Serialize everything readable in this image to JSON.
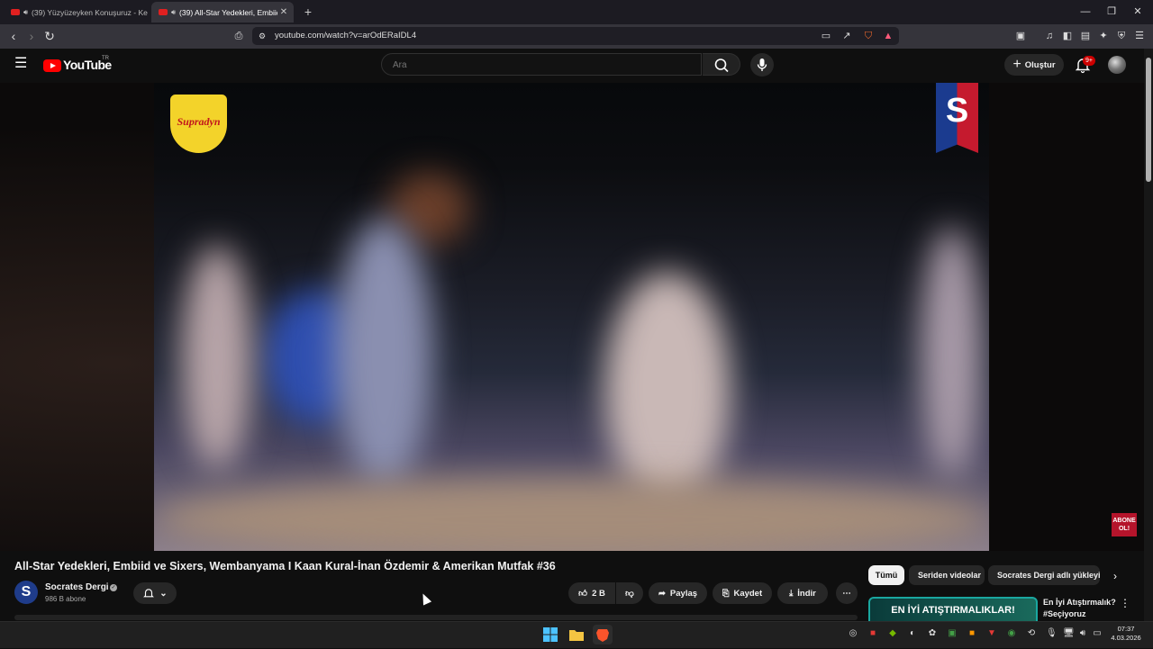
{
  "browser": {
    "tabs": [
      {
        "title": "(39) Yüzyüzeyken Konuşuruz - Ke",
        "active": false
      },
      {
        "title": "(39) All-Star Yedekleri, Embiid",
        "active": true
      }
    ],
    "url": "youtube.com/watch?v=arOdERaIDL4"
  },
  "youtube": {
    "logo_text": "YouTube",
    "country": "TR",
    "search_placeholder": "Ara",
    "create_label": "Oluştur",
    "notification_count": "9+"
  },
  "video": {
    "sponsor_text": "Supradyn",
    "channel_bug_letter": "S",
    "subscribe_bug": "ABONE OL!",
    "title": "All-Star Yedekleri, Embiid ve Sixers, Wembanyama I Kaan Kural-İnan Özdemir & Amerikan Mutfak #36"
  },
  "channel": {
    "avatar_letter": "S",
    "name": "Socrates Dergi",
    "subscribers": "986 B abone"
  },
  "actions": {
    "likes": "2 B",
    "share": "Paylaş",
    "save": "Kaydet",
    "download": "İndir"
  },
  "chips": [
    "Tümü",
    "Seriden videolar",
    "Socrates Dergi adlı yükleyici"
  ],
  "recommendation": {
    "thumb_text": "EN İYİ ATIŞTIRMALIKLAR!",
    "title": "En İyi Atıştırmalık? #Seçiyoruz"
  },
  "taskbar": {
    "time": "07:37",
    "date": "4.03.2026"
  },
  "colors": {
    "yt_red": "#ff0000",
    "background": "#0f0f0f",
    "pill_bg": "#272727",
    "badge_red": "#cc0000"
  }
}
